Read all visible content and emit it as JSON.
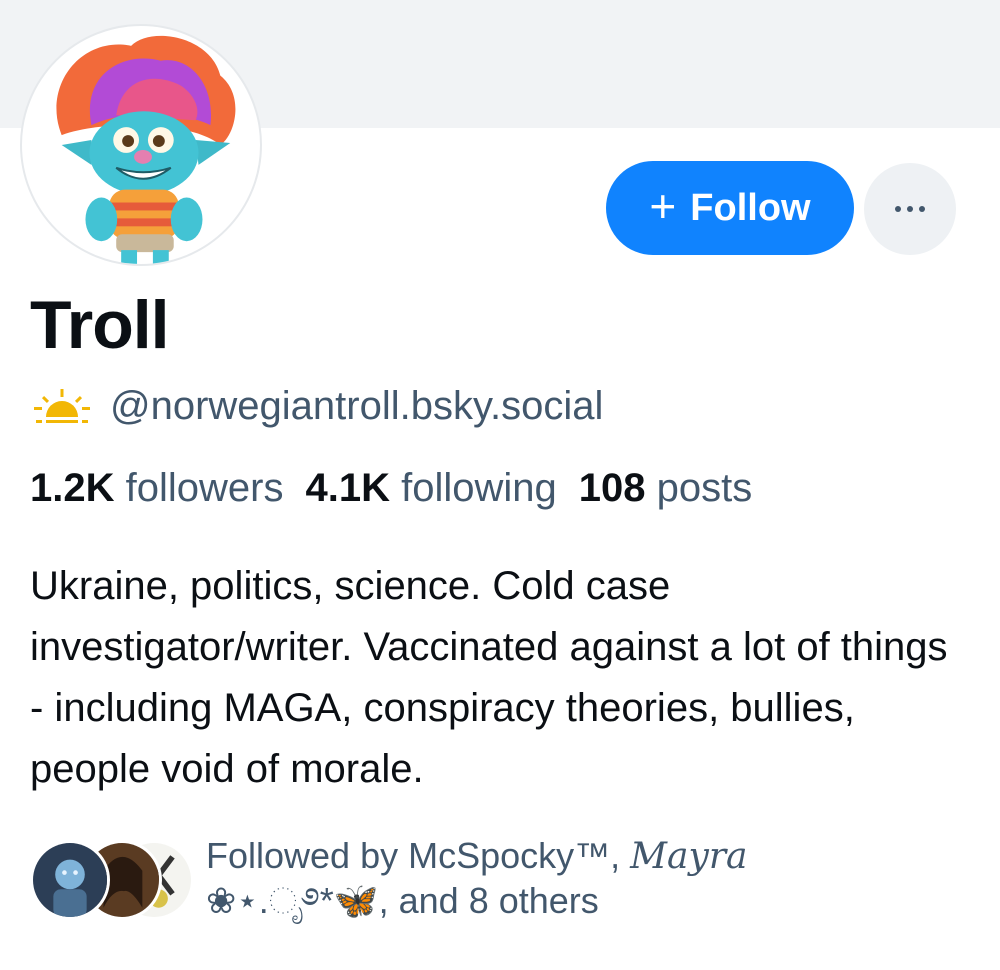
{
  "profile": {
    "display_name": "Troll",
    "handle": "@norwegiantroll.bsky.social",
    "handle_icon": "sun-icon",
    "avatar_icon": "troll-avatar"
  },
  "actions": {
    "follow_label": "Follow",
    "follow_icon": "plus-icon",
    "more_icon": "ellipsis-icon"
  },
  "stats": {
    "followers_count": "1.2K",
    "followers_label": "followers",
    "following_count": "4.1K",
    "following_label": "following",
    "posts_count": "108",
    "posts_label": "posts"
  },
  "bio": "Ukraine, politics, science. Cold case investigator/writer. Vaccinated against a lot of things - including MAGA, conspiracy theories, bullies, people void of morale.",
  "followed_by": {
    "prefix": "Followed by McSpocky™,",
    "second_name": "𝑀𝑎𝑦𝑟𝑎",
    "decoration": "❀⋆.ೃ࿔*🦋",
    "suffix": ", and 8 others"
  },
  "colors": {
    "accent": "#1083fe",
    "muted_text": "#42576c",
    "banner": "#f1f3f5"
  }
}
